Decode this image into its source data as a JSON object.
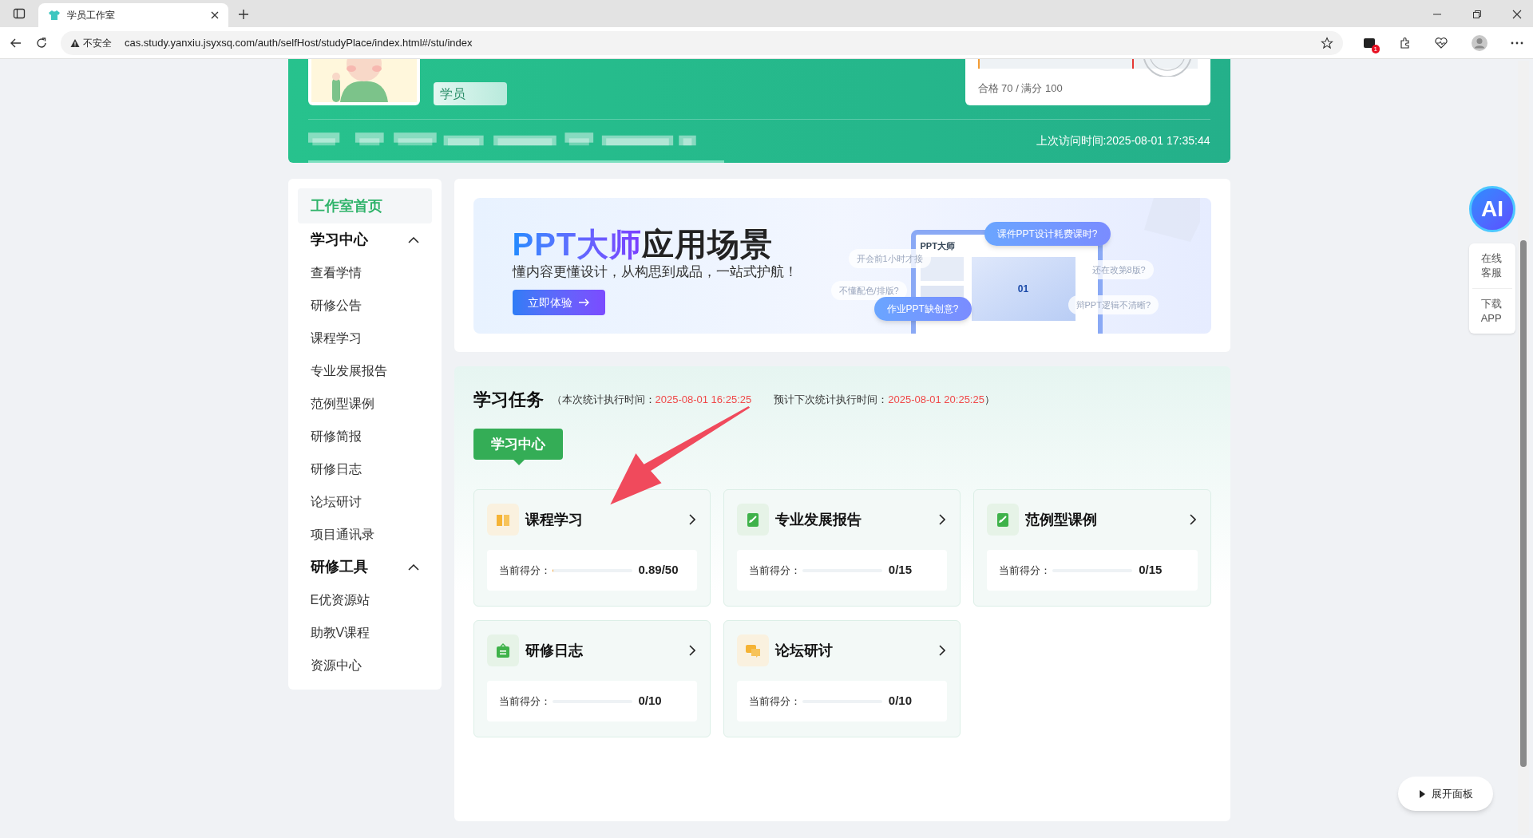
{
  "browser": {
    "tab_title": "学员工作室",
    "security": "不安全",
    "url": "cas.study.yanxiu.jsyxsq.com/auth/selfHost/studyPlace/index.html#/stu/index",
    "extension_badge": "1"
  },
  "header": {
    "role": "学员",
    "score_card": {
      "text": "合格 70 / 满分 100"
    },
    "last_visit": "上次访问时间:2025-08-01 17:35:44"
  },
  "sidebar": {
    "items": [
      {
        "kind": "link",
        "label": "工作室首页",
        "selected": true
      },
      {
        "kind": "section",
        "label": "学习中心",
        "expanded": true,
        "children": [
          {
            "kind": "link",
            "label": "查看学情",
            "selected": false
          },
          {
            "kind": "link",
            "label": "研修公告",
            "selected": false
          },
          {
            "kind": "link",
            "label": "课程学习",
            "selected": false
          },
          {
            "kind": "link",
            "label": "专业发展报告",
            "selected": false
          },
          {
            "kind": "link",
            "label": "范例型课例",
            "selected": false
          },
          {
            "kind": "link",
            "label": "研修简报",
            "selected": false
          },
          {
            "kind": "link",
            "label": "研修日志",
            "selected": false
          },
          {
            "kind": "link",
            "label": "论坛研讨",
            "selected": false
          },
          {
            "kind": "link",
            "label": "项目通讯录",
            "selected": false
          }
        ]
      },
      {
        "kind": "section",
        "label": "研修工具",
        "expanded": true,
        "children": [
          {
            "kind": "link",
            "label": "E优资源站",
            "selected": false
          },
          {
            "kind": "link",
            "label": "助教V课程",
            "selected": false
          },
          {
            "kind": "link",
            "label": "资源中心",
            "selected": false
          }
        ]
      }
    ]
  },
  "banner": {
    "title_highlight": "PPT大师",
    "title_rest": "应用场景",
    "subtitle": "懂内容更懂设计，从构思到成品，一站式护航！",
    "button": "立即体验",
    "mock_logo": "PPT大师",
    "mock_slide": "01",
    "bubbles": [
      {
        "kind": "faint",
        "text": "开会前1小时才接"
      },
      {
        "kind": "faint",
        "text": "不懂配色/排版?"
      },
      {
        "kind": "main",
        "text": "课件PPT设计耗费课时?"
      },
      {
        "kind": "main",
        "text": "作业PPT缺创意?"
      },
      {
        "kind": "faint",
        "text": "还在改第8版?"
      },
      {
        "kind": "faint",
        "text": "辩PPT逻辑不清晰?"
      }
    ]
  },
  "tasks": {
    "title": "学习任务",
    "stat_label": "（本次统计执行时间：",
    "stat_time": "2025-08-01 16:25:25",
    "next_label": "预计下次统计执行时间：",
    "next_time": "2025-08-01 20:25:25",
    "close_paren": "）",
    "tabs": [
      {
        "label": "学习中心",
        "selected": true
      }
    ],
    "cards": [
      {
        "kind": "book",
        "title": "课程学习",
        "score_label": "当前得分：",
        "score": "0.89/50",
        "level": 0.018
      },
      {
        "kind": "note",
        "title": "专业发展报告",
        "score_label": "当前得分：",
        "score": "0/15"
      },
      {
        "kind": "note",
        "title": "范例型课例",
        "score_label": "当前得分：",
        "score": "0/15"
      },
      {
        "kind": "bag",
        "title": "研修日志",
        "score_label": "当前得分：",
        "score": "0/10"
      },
      {
        "kind": "chat",
        "title": "论坛研讨",
        "score_label": "当前得分：",
        "score": "0/10"
      }
    ]
  },
  "float_panel": {
    "ai": "AI",
    "items": [
      "在线客服",
      "下载APP"
    ]
  },
  "expand_button": "展开面板"
}
